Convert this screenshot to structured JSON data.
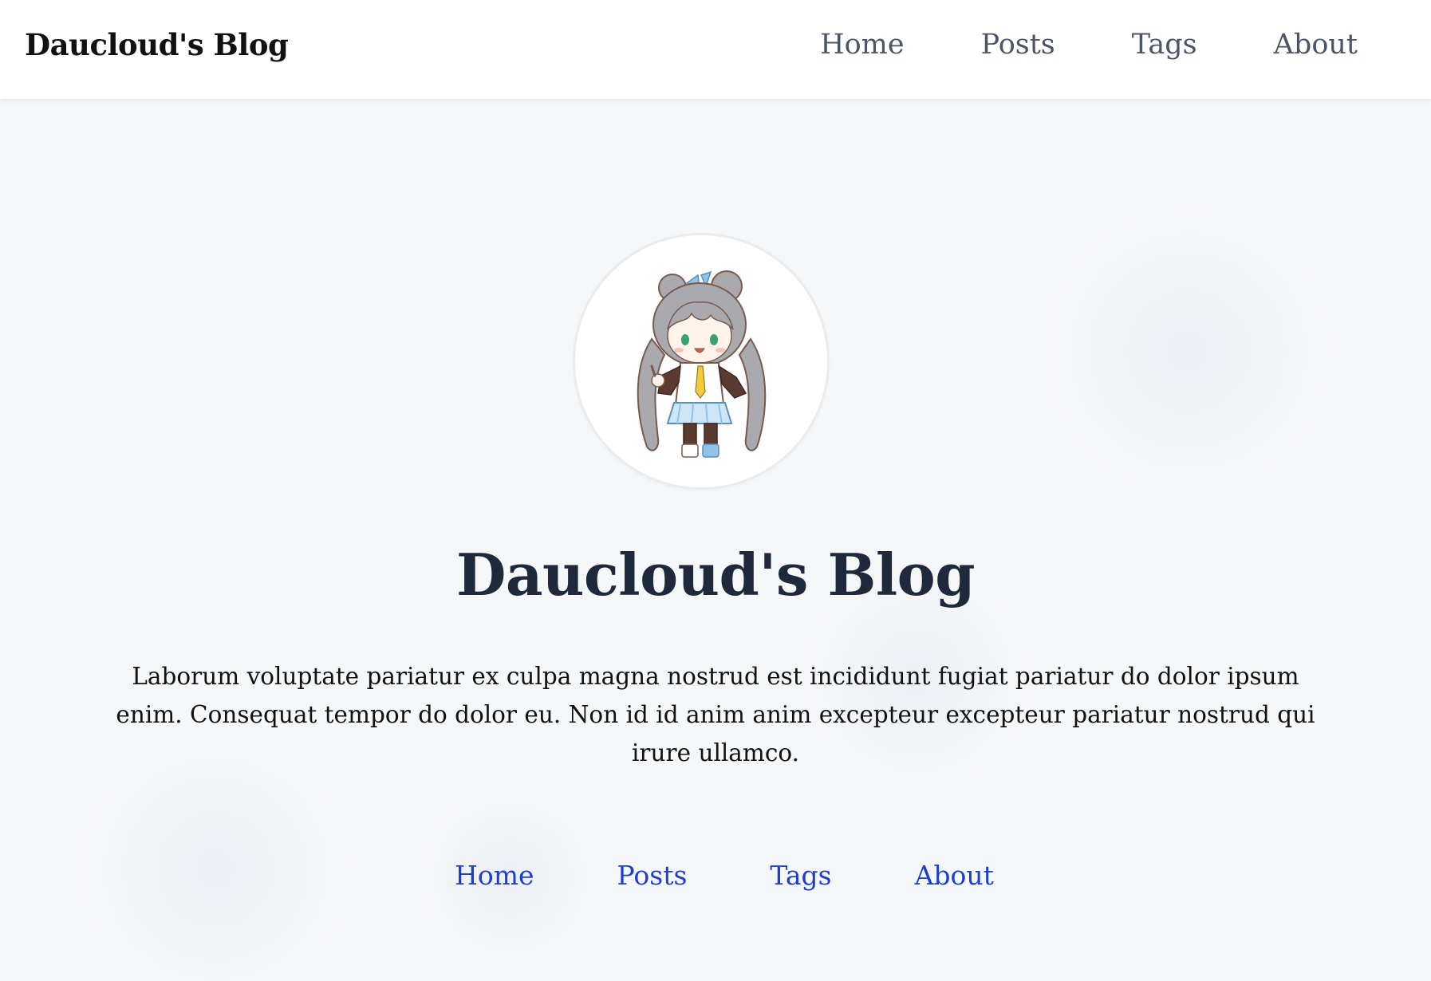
{
  "header": {
    "brand": "Daucloud's Blog",
    "nav": [
      "Home",
      "Posts",
      "Tags",
      "About"
    ]
  },
  "hero": {
    "avatar_icon": "chibi-character-avatar",
    "title": "Daucloud's Blog",
    "description": "Laborum voluptate pariatur ex culpa magna nostrud est incididunt fugiat pariatur do dolor ipsum enim. Consequat tempor do dolor eu. Non id id anim anim excepteur excepteur pariatur nostrud qui irure ullamco.",
    "nav": [
      "Home",
      "Posts",
      "Tags",
      "About"
    ]
  },
  "colors": {
    "background": "#f6f7f9",
    "header_bg": "#ffffff",
    "top_nav_text": "#4a5568",
    "hero_title": "#1e2a3b",
    "hero_link": "#1d3fcf"
  }
}
